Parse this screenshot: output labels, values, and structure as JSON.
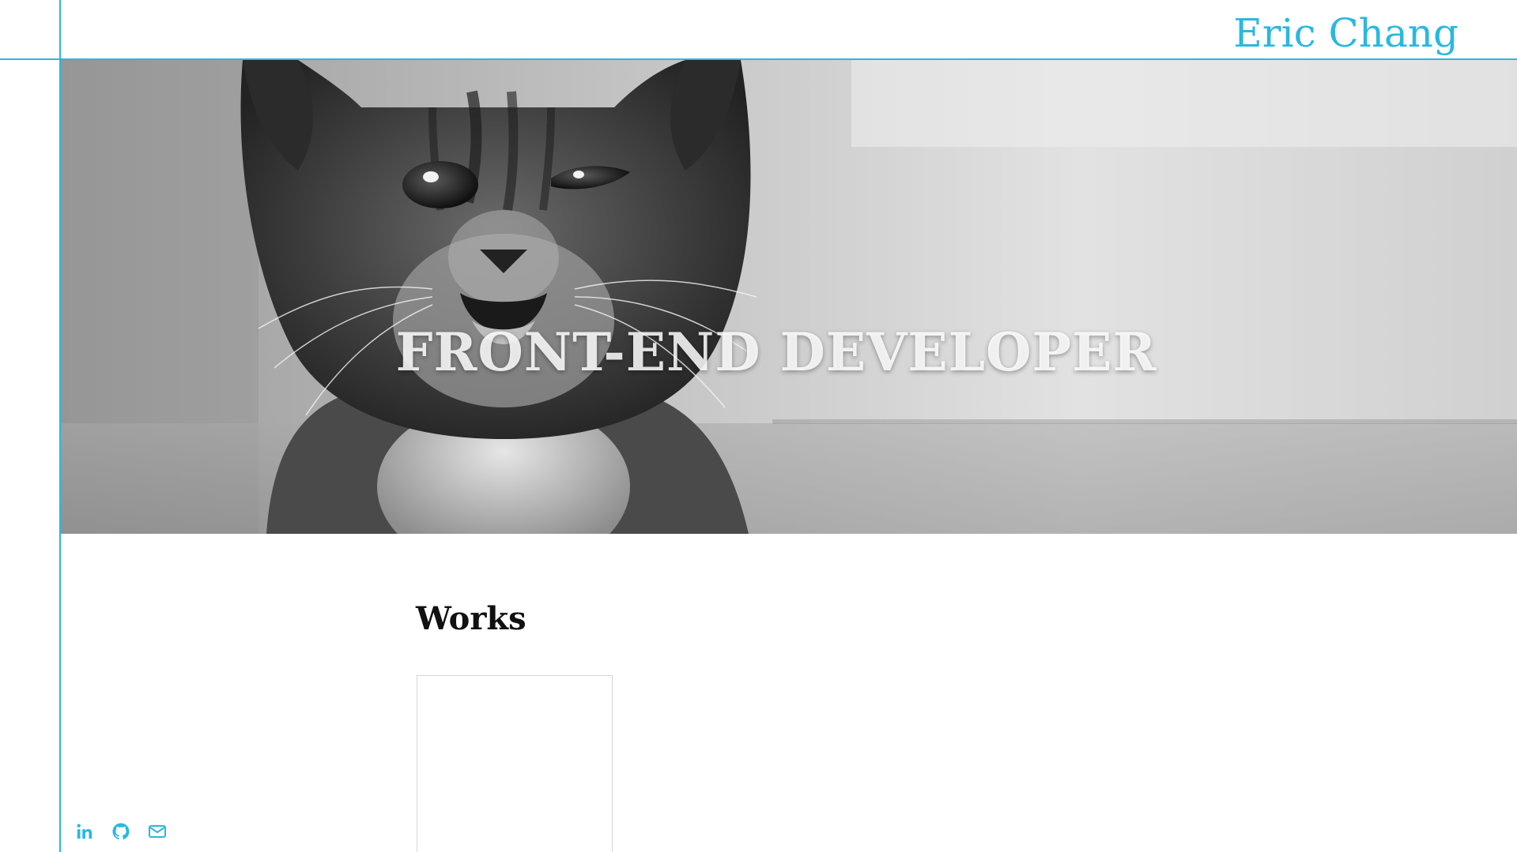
{
  "site": {
    "brand": "Eric Chang",
    "accent_color": "#29b8e0"
  },
  "hero": {
    "title": "FRONT-END DEVELOPER",
    "image": "grayscale-kitten-photo"
  },
  "works": {
    "title": "Works",
    "cards": [
      {
        "image": "blank"
      }
    ]
  },
  "social": {
    "items": [
      {
        "icon": "linkedin-icon"
      },
      {
        "icon": "github-icon"
      },
      {
        "icon": "envelope-icon"
      }
    ]
  }
}
